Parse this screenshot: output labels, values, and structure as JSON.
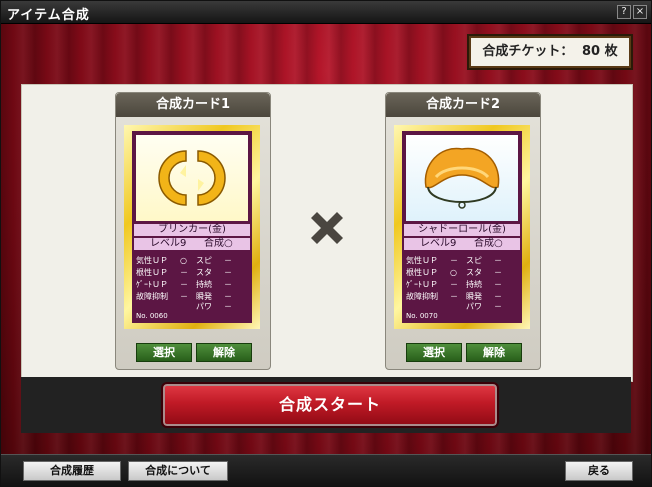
{
  "window": {
    "title": "アイテム合成",
    "help_label": "?",
    "close_label": "×"
  },
  "ticket": {
    "label": "合成チケット：",
    "count": "80",
    "unit": "枚"
  },
  "cards": [
    {
      "header": "合成カード1",
      "name": "ブリンカー(金)",
      "level": "レベル9",
      "synth": "合成○",
      "stats": [
        {
          "k1": "気性ＵＰ",
          "v1": "○",
          "k2": "スピ",
          "v2": "－"
        },
        {
          "k1": "根性ＵＰ",
          "v1": "－",
          "k2": "スタ",
          "v2": "－"
        },
        {
          "k1": "ｹﾞｰﾄＵＰ",
          "v1": "－",
          "k2": "持続",
          "v2": "－"
        },
        {
          "k1": "故障抑制",
          "v1": "－",
          "k2": "瞬発",
          "v2": "－"
        },
        {
          "k1": "",
          "v1": "",
          "k2": "パワ",
          "v2": "－"
        }
      ],
      "number": "No. 0060",
      "select_label": "選択",
      "remove_label": "解除"
    },
    {
      "header": "合成カード2",
      "name": "シャドーロール(金)",
      "level": "レベル9",
      "synth": "合成○",
      "stats": [
        {
          "k1": "気性ＵＰ",
          "v1": "－",
          "k2": "スピ",
          "v2": "－"
        },
        {
          "k1": "根性ＵＰ",
          "v1": "○",
          "k2": "スタ",
          "v2": "－"
        },
        {
          "k1": "ｹﾞｰﾄＵＰ",
          "v1": "－",
          "k2": "持続",
          "v2": "－"
        },
        {
          "k1": "故障抑制",
          "v1": "－",
          "k2": "瞬発",
          "v2": "－"
        },
        {
          "k1": "",
          "v1": "",
          "k2": "パワ",
          "v2": "－"
        }
      ],
      "number": "No. 0070",
      "select_label": "選択",
      "remove_label": "解除"
    }
  ],
  "start_button": "合成スタート",
  "footer": {
    "history_label": "合成履歴",
    "about_label": "合成について",
    "back_label": "戻る"
  },
  "icons": {
    "times": "multiply-icon",
    "blinker": "blinker-gold-icon",
    "shadow_roll": "shadow-roll-gold-icon"
  },
  "colors": {
    "accent_red": "#c01a26",
    "card_purple": "#5c1644",
    "card_gold": "#f0c820",
    "select_green": "#3a7a2a"
  }
}
